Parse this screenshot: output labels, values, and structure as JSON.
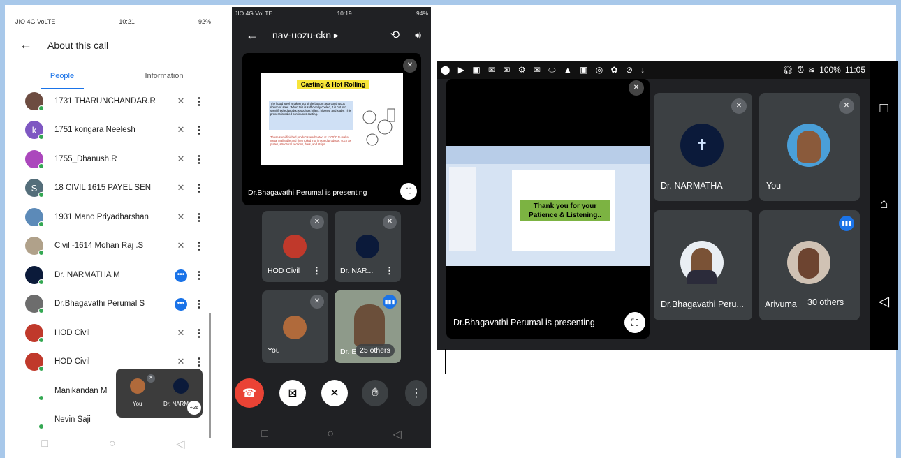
{
  "phone1": {
    "status": {
      "left": "JIO 4G VoLTE",
      "time": "10:21",
      "right": "92%"
    },
    "header": {
      "back": "←",
      "title": "About this call"
    },
    "tabs": [
      "People",
      "Information"
    ],
    "people": [
      {
        "name": "1731 THARUNCHANDAR.R",
        "avatar_color": "#6d4c41",
        "letter": "",
        "state": "muted"
      },
      {
        "name": "1751 kongara Neelesh",
        "avatar_color": "#7e57c2",
        "letter": "k",
        "state": "muted"
      },
      {
        "name": "1755_Dhanush.R",
        "avatar_color": "#ab47bc",
        "letter": "",
        "state": "muted"
      },
      {
        "name": "18 CIVIL 1615 PAYEL SEN",
        "avatar_color": "#546e7a",
        "letter": "S",
        "state": "muted"
      },
      {
        "name": "1931 Mano Priyadharshan",
        "avatar_color": "#5c8ab8",
        "letter": "",
        "state": "muted"
      },
      {
        "name": "Civil -1614 Mohan Raj .S",
        "avatar_color": "#b0a18a",
        "letter": "",
        "state": "muted"
      },
      {
        "name": "Dr. NARMATHA M",
        "avatar_color": "#0b1a3a",
        "letter": "",
        "state": "talking"
      },
      {
        "name": "Dr.Bhagavathi Perumal S",
        "avatar_color": "#6d6d6d",
        "letter": "",
        "state": "talking"
      },
      {
        "name": "HOD Civil",
        "avatar_color": "#c0392b",
        "letter": "",
        "state": "muted"
      },
      {
        "name": "HOD Civil",
        "avatar_color": "#c0392b",
        "letter": "",
        "state": "muted"
      },
      {
        "name": "Manikandan M",
        "avatar_color": "#ffffff",
        "letter": "",
        "state": "none"
      },
      {
        "name": "Nevin Saji",
        "avatar_color": "#ffffff",
        "letter": "",
        "state": "none"
      }
    ],
    "pip": {
      "you": "You",
      "other": "Dr. NARM",
      "badge": "+26"
    }
  },
  "phone2": {
    "status": {
      "left": "JIO 4G VoLTE",
      "time": "10:19",
      "right": "94%"
    },
    "meeting_code": "nav-uozu-ckn",
    "slide": {
      "title": "Casting & Hot Rolling",
      "para1": "The liquid steel is taken out of the bottom as a continuous ribbon of steel. When this is sufficiently cooled, it is cut into semi-finished products such as billets, blooms, and slabs. This process is called continuous casting.",
      "para2": "These semi-finished products are heated at 1200°C to make metal malleable and then rolled into finished products, such as plates, structural sections, bars, and strips."
    },
    "presenting_label": "Dr.Bhagavathi Perumal is presenting",
    "tiles": [
      {
        "label": "HOD Civil"
      },
      {
        "label": "Dr. NAR..."
      },
      {
        "label": "You"
      },
      {
        "label": "Dr. E"
      }
    ],
    "others_label": "25 others"
  },
  "tablet": {
    "status": {
      "time": "11:05",
      "battery": "100%"
    },
    "slide_text": "Thank you for your Patience & Listening..",
    "presenting_label": "Dr.Bhagavathi Perumal is presenting",
    "tiles": [
      {
        "label": "Dr. NARMATHA"
      },
      {
        "label": "You"
      },
      {
        "label": "Dr.Bhagavathi Peru..."
      },
      {
        "label": "Arivuma"
      }
    ],
    "others_label": "30 others"
  }
}
